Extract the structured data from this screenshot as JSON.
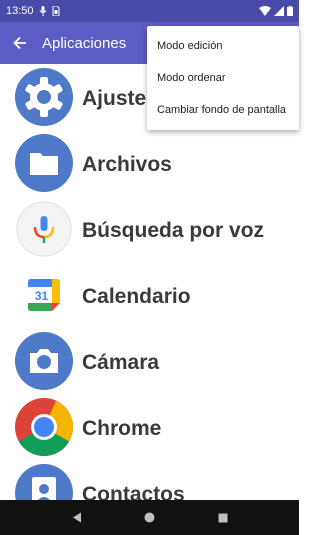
{
  "status_bar": {
    "time": "13:50",
    "icons": [
      "mic-icon",
      "sim-icon",
      "wifi-icon",
      "signal-icon",
      "battery-icon"
    ]
  },
  "app_bar": {
    "title": "Aplicaciones",
    "back_icon": "arrow-back-icon",
    "background": "#5c5cc4"
  },
  "apps": [
    {
      "label": "Ajustes",
      "icon": "settings-icon"
    },
    {
      "label": "Archivos",
      "icon": "files-icon"
    },
    {
      "label": "Búsqueda por voz",
      "icon": "voice-search-icon"
    },
    {
      "label": "Calendario",
      "icon": "calendar-icon",
      "icon_text": "31"
    },
    {
      "label": "Cámara",
      "icon": "camera-icon"
    },
    {
      "label": "Chrome",
      "icon": "chrome-icon"
    },
    {
      "label": "Contactos",
      "icon": "contacts-icon"
    }
  ],
  "menu": {
    "items": [
      {
        "label": "Modo edición"
      },
      {
        "label": "Modo ordenar"
      },
      {
        "label": "Cambiar fondo de pantalla"
      }
    ]
  },
  "nav_bar": {
    "icons": [
      "back-triangle-icon",
      "home-circle-icon",
      "recents-square-icon"
    ]
  }
}
